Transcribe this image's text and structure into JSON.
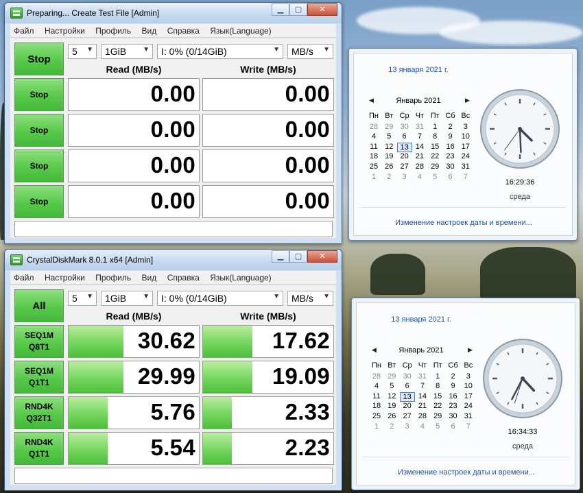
{
  "window1": {
    "title": "Preparing... Create Test File [Admin]",
    "menu": [
      "Файл",
      "Настройки",
      "Профиль",
      "Вид",
      "Справка",
      "Язык(Language)"
    ],
    "main_button": "Stop",
    "count": "5",
    "size": "1GiB",
    "drive": "I: 0% (0/14GiB)",
    "unit": "MB/s",
    "read_header": "Read (MB/s)",
    "write_header": "Write (MB/s)",
    "rows": [
      {
        "label1": "Stop",
        "label2": "",
        "read": "0.00",
        "write": "0.00",
        "read_fill": 0,
        "write_fill": 0
      },
      {
        "label1": "Stop",
        "label2": "",
        "read": "0.00",
        "write": "0.00",
        "read_fill": 0,
        "write_fill": 0
      },
      {
        "label1": "Stop",
        "label2": "",
        "read": "0.00",
        "write": "0.00",
        "read_fill": 0,
        "write_fill": 0
      },
      {
        "label1": "Stop",
        "label2": "",
        "read": "0.00",
        "write": "0.00",
        "read_fill": 0,
        "write_fill": 0
      }
    ]
  },
  "window2": {
    "title": "CrystalDiskMark 8.0.1 x64 [Admin]",
    "menu": [
      "Файл",
      "Настройки",
      "Профиль",
      "Вид",
      "Справка",
      "Язык(Language)"
    ],
    "main_button": "All",
    "count": "5",
    "size": "1GiB",
    "drive": "I: 0% (0/14GiB)",
    "unit": "MB/s",
    "read_header": "Read (MB/s)",
    "write_header": "Write (MB/s)",
    "rows": [
      {
        "label1": "SEQ1M",
        "label2": "Q8T1",
        "read": "30.62",
        "write": "17.62",
        "read_fill": 0.42,
        "write_fill": 0.38
      },
      {
        "label1": "SEQ1M",
        "label2": "Q1T1",
        "read": "29.99",
        "write": "19.09",
        "read_fill": 0.42,
        "write_fill": 0.38
      },
      {
        "label1": "RND4K",
        "label2": "Q32T1",
        "read": "5.76",
        "write": "2.33",
        "read_fill": 0.3,
        "write_fill": 0.22
      },
      {
        "label1": "RND4K",
        "label2": "Q1T1",
        "read": "5.54",
        "write": "2.23",
        "read_fill": 0.3,
        "write_fill": 0.22
      }
    ]
  },
  "calendar1": {
    "date_header": "13 января 2021 г.",
    "month": "Январь 2021",
    "weekdays": [
      "Пн",
      "Вт",
      "Ср",
      "Чт",
      "Пт",
      "Сб",
      "Вс"
    ],
    "weeks": [
      [
        "28",
        "29",
        "30",
        "31",
        "1",
        "2",
        "3"
      ],
      [
        "4",
        "5",
        "6",
        "7",
        "8",
        "9",
        "10"
      ],
      [
        "11",
        "12",
        "13",
        "14",
        "15",
        "16",
        "17"
      ],
      [
        "18",
        "19",
        "20",
        "21",
        "22",
        "23",
        "24"
      ],
      [
        "25",
        "26",
        "27",
        "28",
        "29",
        "30",
        "31"
      ],
      [
        "1",
        "2",
        "3",
        "4",
        "5",
        "6",
        "7"
      ]
    ],
    "time": "16:29:36",
    "day": "среда",
    "link": "Изменение настроек даты и времени..."
  },
  "calendar2": {
    "date_header": "13 января 2021 г.",
    "month": "Январь 2021",
    "weekdays": [
      "Пн",
      "Вт",
      "Ср",
      "Чт",
      "Пт",
      "Сб",
      "Вс"
    ],
    "weeks": [
      [
        "28",
        "29",
        "30",
        "31",
        "1",
        "2",
        "3"
      ],
      [
        "4",
        "5",
        "6",
        "7",
        "8",
        "9",
        "10"
      ],
      [
        "11",
        "12",
        "13",
        "14",
        "15",
        "16",
        "17"
      ],
      [
        "18",
        "19",
        "20",
        "21",
        "22",
        "23",
        "24"
      ],
      [
        "25",
        "26",
        "27",
        "28",
        "29",
        "30",
        "31"
      ],
      [
        "1",
        "2",
        "3",
        "4",
        "5",
        "6",
        "7"
      ]
    ],
    "time": "16:34:33",
    "day": "среда",
    "link": "Изменение настроек даты и времени..."
  },
  "colors": {
    "accent_green": "#57c94a",
    "link_blue": "#1f4e9a"
  },
  "icons": [
    "crystaldiskmark-app-icon",
    "minimize-icon",
    "maximize-icon",
    "close-icon",
    "chevron-down-icon",
    "chevron-left-icon",
    "chevron-right-icon",
    "analog-clock-icon"
  ]
}
